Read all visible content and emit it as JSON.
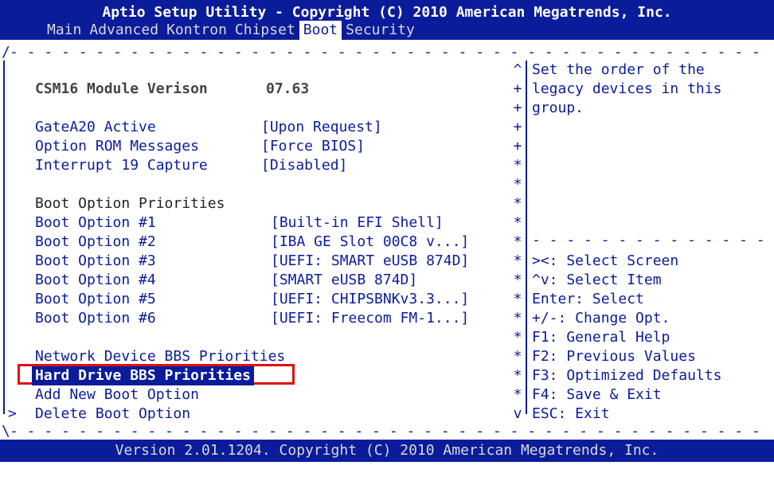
{
  "header": {
    "title": "Aptio Setup Utility - Copyright (C) 2010 American Megatrends, Inc.",
    "tabs": [
      {
        "label": "Main",
        "active": false
      },
      {
        "label": "Advanced",
        "active": false
      },
      {
        "label": "Kontron",
        "active": false
      },
      {
        "label": "Chipset",
        "active": false
      },
      {
        "label": "Boot",
        "active": true
      },
      {
        "label": "Security",
        "active": false
      }
    ]
  },
  "items": {
    "csm_label": "CSM16 Module Verison",
    "csm_value": "07.63",
    "gatea20_label": "GateA20 Active",
    "gatea20_value": "[Upon Request]",
    "optrom_label": "Option ROM Messages",
    "optrom_value": "[Force BIOS]",
    "int19_label": "Interrupt 19 Capture",
    "int19_value": "[Disabled]",
    "boot_priorities_heading": "Boot Option Priorities",
    "boot_options": [
      {
        "label": "Boot Option #1",
        "value": "[Built-in EFI Shell]"
      },
      {
        "label": "Boot Option #2",
        "value": "[IBA GE Slot 00C8 v...]"
      },
      {
        "label": "Boot Option #3",
        "value": "[UEFI: SMART eUSB 874D]"
      },
      {
        "label": "Boot Option #4",
        "value": "[SMART eUSB 874D]"
      },
      {
        "label": "Boot Option #5",
        "value": "[UEFI: CHIPSBNKv3.3...]"
      },
      {
        "label": "Boot Option #6",
        "value": "[UEFI: Freecom FM-1...]"
      }
    ],
    "network_bbs": "Network Device BBS Priorities",
    "hdd_bbs": "Hard Drive BBS Priorities",
    "add_boot": "Add New Boot Option",
    "delete_boot": "Delete Boot Option",
    "delete_marker": ">"
  },
  "help": {
    "line1": "Set the order of the",
    "line2": "legacy devices in this",
    "line3": "group."
  },
  "keys": {
    "k1": "><: Select Screen",
    "k2": "^v: Select Item",
    "k3": "Enter: Select",
    "k4": "+/-: Change Opt.",
    "k5": "F1: General Help",
    "k6": "F2: Previous Values",
    "k7": "F3: Optimized Defaults",
    "k8": "F4: Save & Exit",
    "k9": "ESC: Exit"
  },
  "scrollbar": [
    "^",
    "+",
    "+",
    "+",
    "+",
    "*",
    "*",
    "*",
    "*",
    "*",
    "*",
    "*",
    "*",
    "*",
    "*",
    "*",
    "*",
    "*",
    "*",
    "v"
  ],
  "footer": "Version 2.01.1204. Copyright (C) 2010 American Megatrends, Inc.",
  "colors": {
    "accent": "#0b1c9a",
    "highlight": "#e01010",
    "background": "#ffffff"
  }
}
